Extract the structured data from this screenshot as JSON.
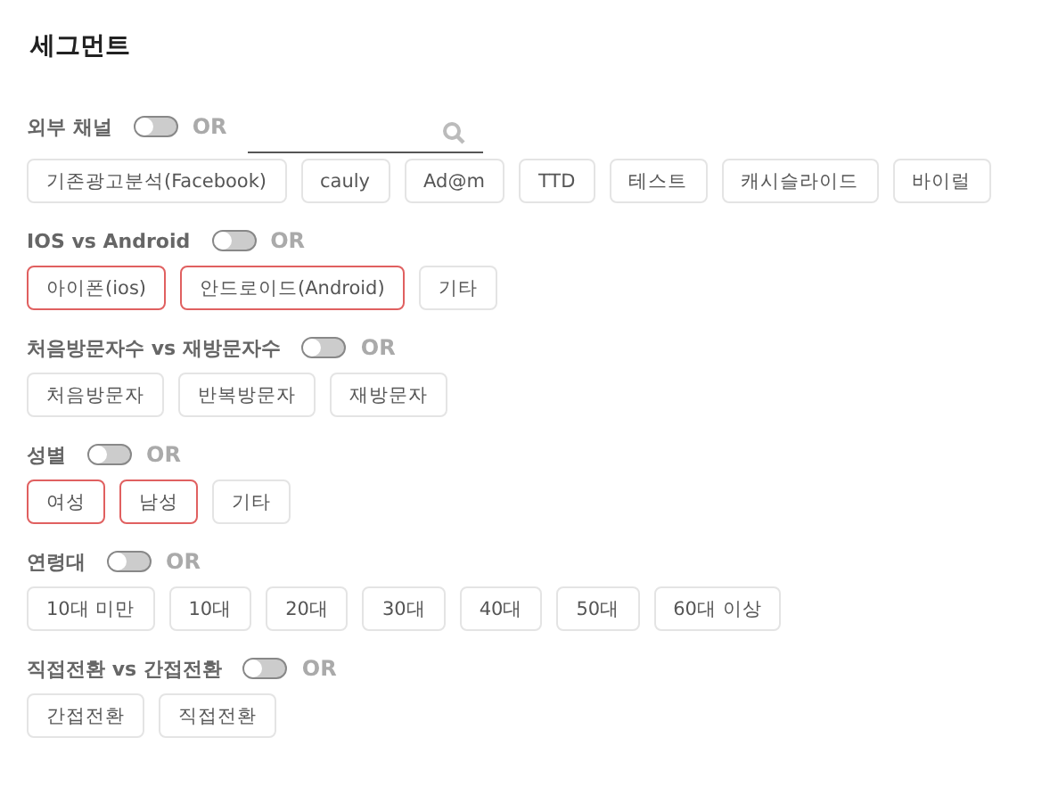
{
  "title": "세그먼트",
  "sections": [
    {
      "label": "외부 채널",
      "toggle_on": false,
      "or_label": "OR",
      "search_field": true,
      "options": [
        {
          "label": "기존광고분석(Facebook)",
          "selected": false
        },
        {
          "label": "cauly",
          "selected": false
        },
        {
          "label": "Ad@m",
          "selected": false
        },
        {
          "label": "TTD",
          "selected": false
        },
        {
          "label": "테스트",
          "selected": false
        },
        {
          "label": "캐시슬라이드",
          "selected": false
        },
        {
          "label": "바이럴",
          "selected": false
        }
      ]
    },
    {
      "label": "IOS vs Android",
      "toggle_on": false,
      "or_label": "OR",
      "options": [
        {
          "label": "아이폰(ios)",
          "selected": true
        },
        {
          "label": "안드로이드(Android)",
          "selected": true
        },
        {
          "label": "기타",
          "selected": false
        }
      ]
    },
    {
      "label": "처음방문자수 vs 재방문자수",
      "toggle_on": false,
      "or_label": "OR",
      "options": [
        {
          "label": "처음방문자",
          "selected": false
        },
        {
          "label": "반복방문자",
          "selected": false
        },
        {
          "label": "재방문자",
          "selected": false
        }
      ]
    },
    {
      "label": "성별",
      "toggle_on": false,
      "or_label": "OR",
      "options": [
        {
          "label": "여성",
          "selected": true
        },
        {
          "label": "남성",
          "selected": true
        },
        {
          "label": "기타",
          "selected": false
        }
      ]
    },
    {
      "label": "연령대",
      "toggle_on": false,
      "or_label": "OR",
      "options": [
        {
          "label": "10대 미만",
          "selected": false
        },
        {
          "label": "10대",
          "selected": false
        },
        {
          "label": "20대",
          "selected": false
        },
        {
          "label": "30대",
          "selected": false
        },
        {
          "label": "40대",
          "selected": false
        },
        {
          "label": "50대",
          "selected": false
        },
        {
          "label": "60대 이상",
          "selected": false
        }
      ]
    },
    {
      "label": "직접전환 vs 간접전환",
      "toggle_on": false,
      "or_label": "OR",
      "options": [
        {
          "label": "간접전환",
          "selected": false
        },
        {
          "label": "직접전환",
          "selected": false
        }
      ]
    }
  ]
}
